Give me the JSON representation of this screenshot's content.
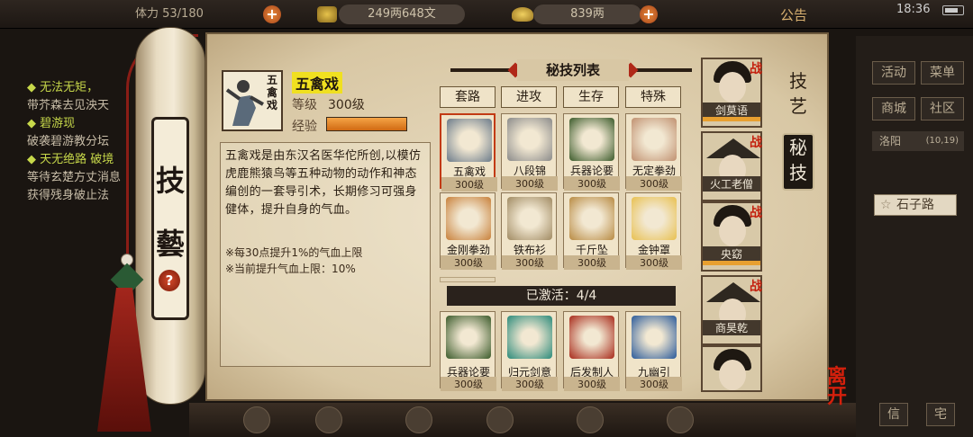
{
  "topbar": {
    "capacity_label": "体力 53/180",
    "money": "249两648文",
    "ingots": "839两",
    "notice": "公告",
    "clock": "18:36"
  },
  "background_left": {
    "lines": [
      {
        "text": "无法无矩，",
        "highlight": true
      },
      {
        "text": "带芥森去见泱天",
        "highlight": false
      },
      {
        "text": "碧游现",
        "highlight": true
      },
      {
        "text": "破袭碧游教分坛",
        "highlight": false
      },
      {
        "text": "天无绝路 破境",
        "highlight": true
      },
      {
        "text": "等待玄楚方丈消息",
        "highlight": false
      },
      {
        "text": "获得残身破止法",
        "highlight": false
      }
    ]
  },
  "background_right": {
    "buttons": [
      "活动",
      "菜单",
      "商城",
      "社区"
    ],
    "city": "洛阳",
    "coords": "(10,19)",
    "road": "石子路",
    "mini_buttons": [
      "信",
      "宅"
    ]
  },
  "scroll": {
    "char1": "技",
    "char2": "藝",
    "help": "?"
  },
  "skill_detail": {
    "name": "五禽戏",
    "level_label": "等级",
    "level_value": "300级",
    "exp_label": "经验",
    "exp_fraction": 1.0,
    "portrait_text": "五禽戏",
    "description": "五禽戏是由东汉名医华佗所创,以模仿虎鹿熊猿鸟等五种动物的动作和神态编创的一套导引术，长期修习可强身健体，提升自身的气血。",
    "note1": "※每30点提升1%的气血上限",
    "note2": "※当前提升气血上限：10%"
  },
  "skill_list": {
    "title": "秘技列表",
    "tabs": [
      "套路",
      "进攻",
      "生存",
      "特殊"
    ],
    "skills": [
      {
        "name": "五禽戏",
        "level": "300级",
        "color": "#6a7a8a"
      },
      {
        "name": "八段锦",
        "level": "300级",
        "color": "#8a8a8a"
      },
      {
        "name": "兵器论要",
        "level": "300级",
        "color": "#3a5a2a"
      },
      {
        "name": "无定拳劲",
        "level": "300级",
        "color": "#c09070"
      },
      {
        "name": "金刚拳劲",
        "level": "300级",
        "color": "#c8803a"
      },
      {
        "name": "铁布衫",
        "level": "300级",
        "color": "#a08a62"
      },
      {
        "name": "千斤坠",
        "level": "300级",
        "color": "#b88a42"
      },
      {
        "name": "金钟罩",
        "level": "300级",
        "color": "#e8c050"
      }
    ],
    "activated_label": "已激活：4/4",
    "activated": [
      {
        "name": "兵器论要",
        "level": "300级",
        "color": "#3a5a2a"
      },
      {
        "name": "归元剑意",
        "level": "300级",
        "color": "#2a8a7a"
      },
      {
        "name": "后发制人",
        "level": "300级",
        "color": "#a82a1a"
      },
      {
        "name": "九幽引",
        "level": "300级",
        "color": "#2a5a9a"
      }
    ]
  },
  "characters": [
    {
      "name": "剑莫语",
      "zhan": "战"
    },
    {
      "name": "火工老僧",
      "zhan": "战"
    },
    {
      "name": "央窈",
      "zhan": "战"
    },
    {
      "name": "商昊乾",
      "zhan": "战"
    },
    {
      "name": "",
      "zhan": ""
    }
  ],
  "side_tabs": {
    "jiyi": "技艺",
    "miji": "秘技"
  },
  "leave": "离开"
}
